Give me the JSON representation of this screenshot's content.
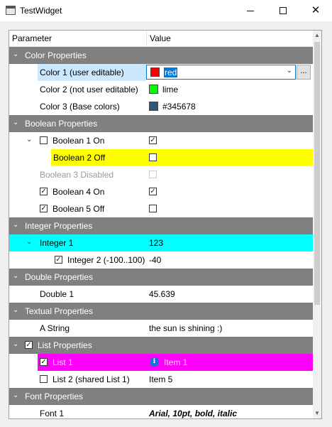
{
  "window": {
    "title": "TestWidget",
    "min_icon": "minimize-icon",
    "max_icon": "maximize-icon",
    "close_icon": "close-icon",
    "close_glyph": "✕"
  },
  "header": {
    "parameter": "Parameter",
    "value": "Value"
  },
  "colors": {
    "category_bg": "#808080",
    "selection_bg": "#cce8ff",
    "yellow": "#ffff00",
    "cyan": "#00ffff",
    "magenta": "#ff00ff"
  },
  "categories": {
    "color": "Color Properties",
    "boolean": "Boolean Properties",
    "integer": "Integer Properties",
    "double": "Double Properties",
    "textual": "Textual Properties",
    "list": "List Properties",
    "font": "Font Properties"
  },
  "color_props": {
    "c1_label": "Color 1 (user editable)",
    "c1_value": "red",
    "c1_swatch": "#ff0000",
    "ellipsis": "...",
    "c2_label": "Color 2 (not user editable)",
    "c2_value": "lime",
    "c2_swatch": "#00ff00",
    "c3_label": "Color 3 (Base colors)",
    "c3_value": "#345678",
    "c3_swatch": "#345678"
  },
  "bool_props": {
    "b1_label": "Boolean 1 On",
    "b1_checked": false,
    "b1_value_checked": true,
    "b2_label": "Boolean 2 Off",
    "b2_value_checked": false,
    "b3_label": "Boolean 3 Disabled",
    "b3_value_checked": false,
    "b4_label": "Boolean 4 On",
    "b4_checked": true,
    "b4_value_checked": true,
    "b5_label": "Boolean 5 Off",
    "b5_checked": true,
    "b5_value_checked": false
  },
  "int_props": {
    "i1_label": "Integer 1",
    "i1_value": "123",
    "i2_label": "Integer 2 (-100..100)",
    "i2_checked": true,
    "i2_value": "-40"
  },
  "double_props": {
    "d1_label": "Double 1",
    "d1_value": "45.639"
  },
  "text_props": {
    "s_label": "A String",
    "s_value": "the sun is shining :)"
  },
  "list_props": {
    "list_checked": true,
    "l1_label": "List 1",
    "l1_checked": true,
    "l1_value": "Item 1",
    "l1_icon": "info-icon",
    "l2_label": "List 2 (shared List 1)",
    "l2_checked": false,
    "l2_value": "Item 5"
  },
  "font_props": {
    "f1_label": "Font 1",
    "f1_value": "Arial, 10pt, bold, italic"
  },
  "glyphs": {
    "expanded": "⌄",
    "check": "✓",
    "chevron": "⌄",
    "scroll_up": "▲",
    "scroll_down": "▼",
    "info": "i"
  }
}
